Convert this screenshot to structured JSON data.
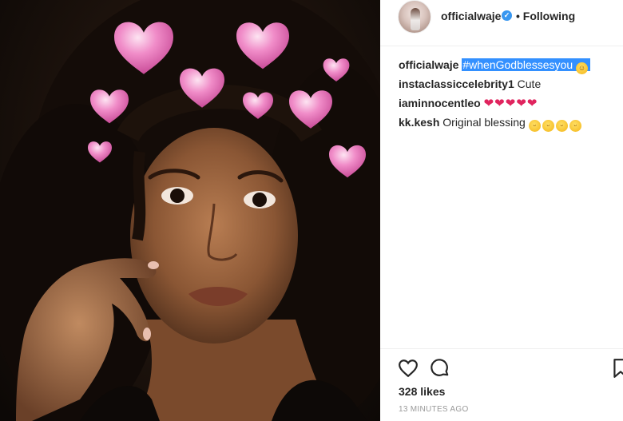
{
  "post": {
    "username": "officialwaje",
    "follow_separator": "•",
    "follow_status": "Following",
    "verified_icon": "verified-badge-icon",
    "likes": "328 likes",
    "timestamp": "13 MINUTES AGO"
  },
  "comments": [
    {
      "user": "officialwaje",
      "text": "#whenGodblessesyou",
      "emoji": "smiling-face-with-hearts",
      "highlighted": true
    },
    {
      "user": "instaclassiccelebrity1",
      "text": "Cute"
    },
    {
      "user": "iaminnocentleo",
      "emoji": "red-heart x5"
    },
    {
      "user": "kk.kesh",
      "text": "Original blessing",
      "emoji": "face-savoring-food x4"
    }
  ],
  "actions": {
    "like_icon": "heart-outline-icon",
    "comment_icon": "comment-icon",
    "save_icon": "bookmark-icon"
  },
  "photo": {
    "description_icon": "selfie-with-heart-crown-filter",
    "filter_color": "#e87ab8"
  },
  "colors": {
    "highlight": "#3390ff",
    "verified": "#3897f0",
    "muted": "#999999"
  }
}
